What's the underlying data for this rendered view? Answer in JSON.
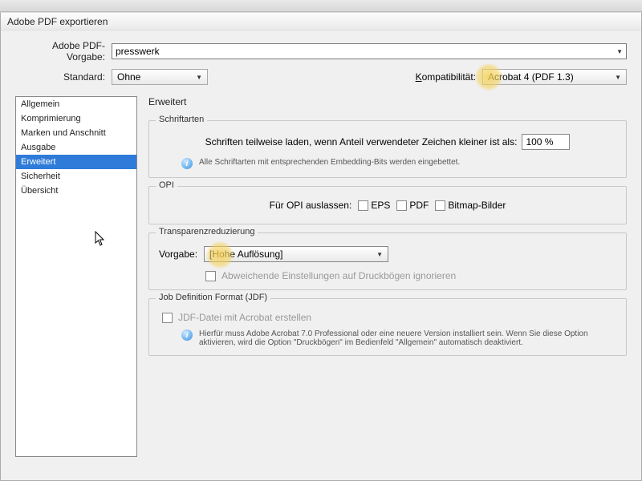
{
  "dialog": {
    "title": "Adobe PDF exportieren"
  },
  "top": {
    "preset_label": "Adobe PDF-Vorgabe:",
    "preset_value": "presswerk",
    "standard_label": "Standard:",
    "standard_value": "Ohne",
    "compat_label_prefix": "K",
    "compat_label_rest": "ompatibilität:",
    "compat_value": "Acrobat 4 (PDF 1.3)"
  },
  "sidebar": {
    "items": [
      {
        "label": "Allgemein"
      },
      {
        "label": "Komprimierung"
      },
      {
        "label": "Marken und Anschnitt"
      },
      {
        "label": "Ausgabe"
      },
      {
        "label": "Erweitert"
      },
      {
        "label": "Sicherheit"
      },
      {
        "label": "Übersicht"
      }
    ],
    "selected_index": 4
  },
  "panel": {
    "title": "Erweitert",
    "fonts": {
      "group_title": "Schriftarten",
      "subset_label": "Schriften teilweise laden, wenn Anteil verwendeter Zeichen kleiner ist als:",
      "subset_value": "100 %",
      "info_text": "Alle Schriftarten mit entsprechenden Embedding-Bits werden eingebettet."
    },
    "opi": {
      "group_title": "OPI",
      "omit_label": "Für OPI auslassen:",
      "opt_eps": "EPS",
      "opt_pdf": "PDF",
      "opt_bitmap": "Bitmap-Bilder"
    },
    "transparency": {
      "group_title": "Transparenzreduzierung",
      "preset_label": "Vorgabe:",
      "preset_value": "[Hohe Auflösung]",
      "ignore_label": "Abweichende Einstellungen auf Druckbögen ignorieren"
    },
    "jdf": {
      "group_title": "Job Definition Format (JDF)",
      "create_label": "JDF-Datei mit Acrobat erstellen",
      "info_text": "Hierfür muss Adobe Acrobat 7.0 Professional oder eine neuere Version installiert sein. Wenn Sie diese Option aktivieren, wird die Option \"Druckbögen\" im Bedienfeld \"Allgemein\" automatisch deaktiviert."
    }
  }
}
